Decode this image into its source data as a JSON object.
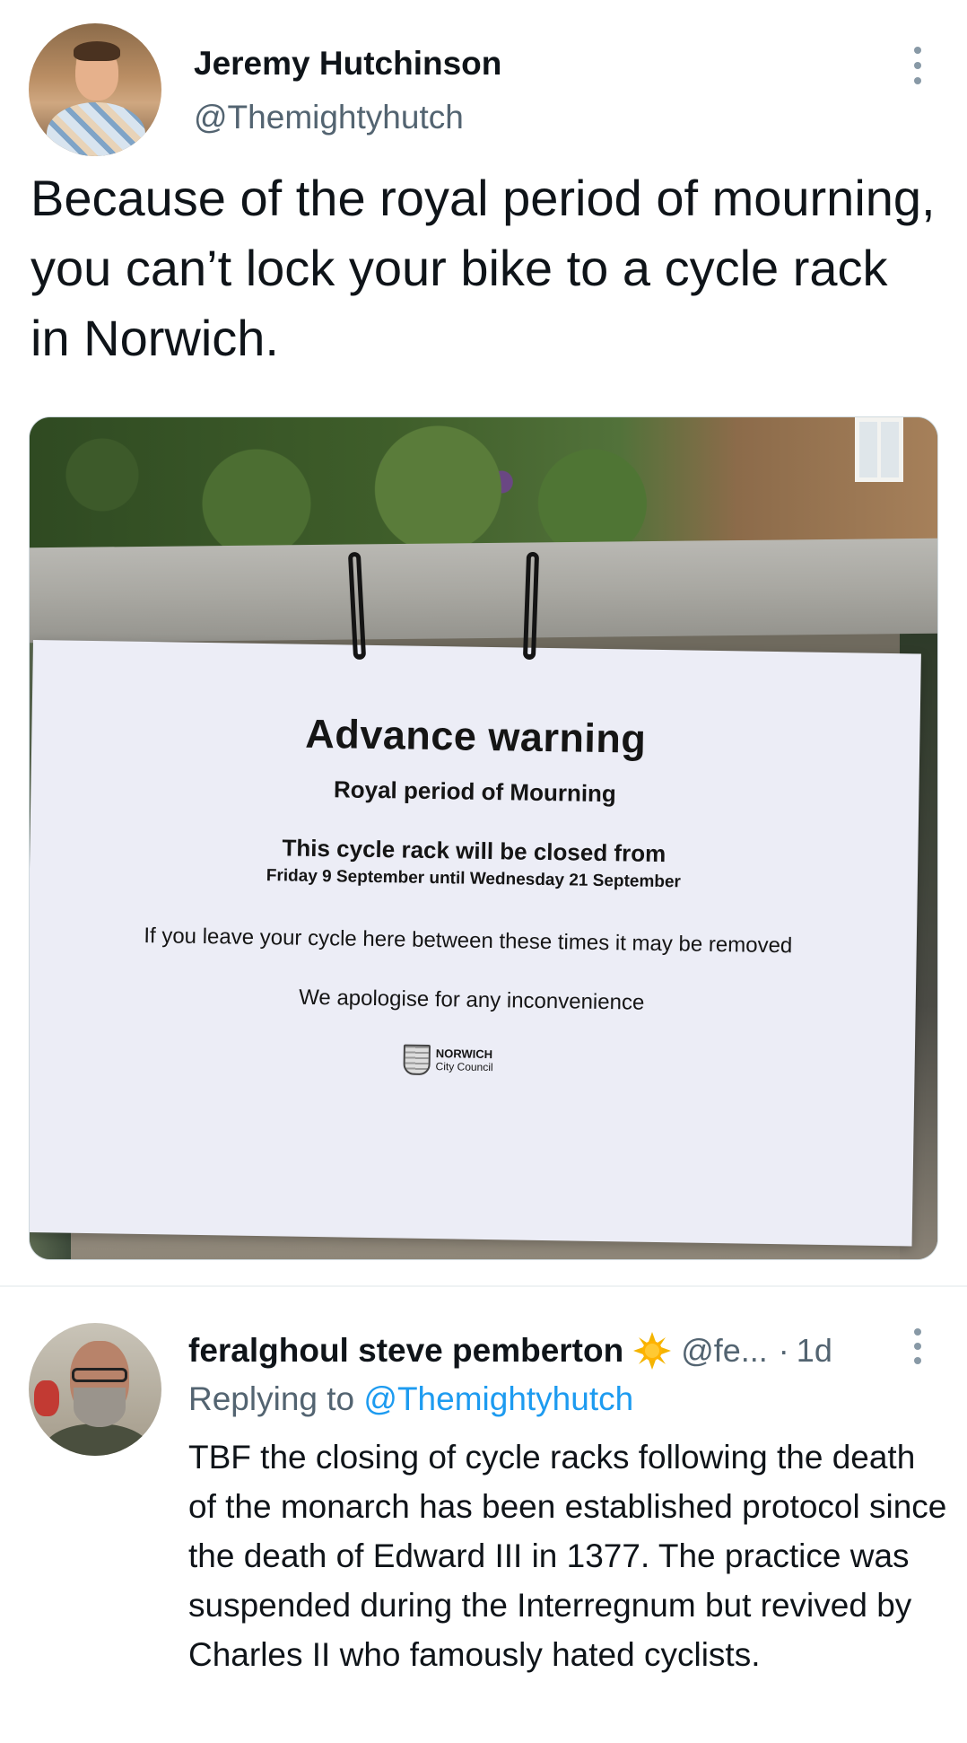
{
  "main_tweet": {
    "author_name": "Jeremy Hutchinson",
    "author_handle": "@Themightyhutch",
    "text": "Because of the royal period of mourning, you can’t lock your bike to a cycle rack in Norwich.",
    "photo_notice": {
      "title": "Advance warning",
      "subtitle": "Royal period of Mourning",
      "closed_line": "This cycle rack will be closed from",
      "dates_line": "Friday 9 September until Wednesday 21 September",
      "leave_line": "If you leave your cycle here between these times it may be removed",
      "apology_line": "We apologise for any inconvenience",
      "logo_line1": "NORWICH",
      "logo_line2": "City Council"
    }
  },
  "reply": {
    "author_name": "feralghoul steve pemberton",
    "badge_icon": "sun-emoji",
    "author_handle": "@fe...",
    "separator": "·",
    "timestamp": "1d",
    "replying_prefix": "Replying to",
    "replying_mention": "@Themightyhutch",
    "text": "TBF the closing of cycle racks following the death of the monarch has been established protocol since the death of Edward III in 1377. The practice was suspended during the Interregnum but revived by Charles II who famously hated cyclists."
  },
  "colors": {
    "text_primary": "#0f1419",
    "text_secondary": "#536471",
    "link": "#1d9bf0",
    "divider": "#eff3f4"
  }
}
